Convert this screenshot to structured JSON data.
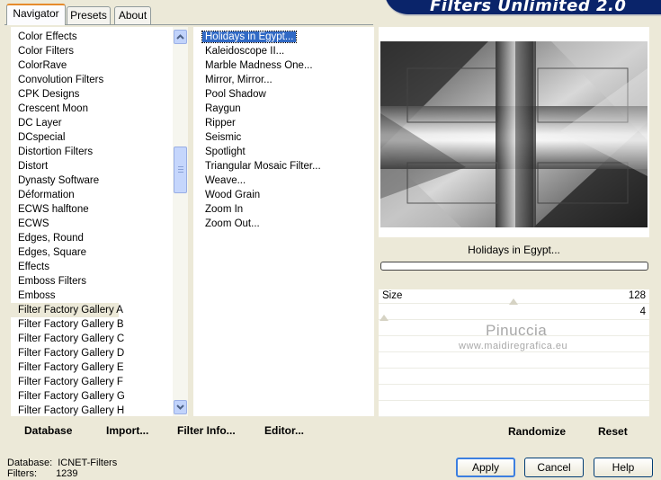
{
  "window": {
    "title": "Filters Unlimited 2.0"
  },
  "tabs": [
    {
      "label": "Navigator"
    },
    {
      "label": "Presets"
    },
    {
      "label": "About"
    }
  ],
  "categories": [
    "Color Effects",
    "Color Filters",
    "ColorRave",
    "Convolution Filters",
    "CPK Designs",
    "Crescent Moon",
    "DC Layer",
    "DCspecial",
    "Distortion Filters",
    "Distort",
    "Dynasty Software",
    "Déformation",
    "ECWS halftone",
    "ECWS",
    "Edges, Round",
    "Edges, Square",
    "Effects",
    "Emboss Filters",
    "Emboss",
    "Filter Factory Gallery A",
    "Filter Factory Gallery B",
    "Filter Factory Gallery C",
    "Filter Factory Gallery D",
    "Filter Factory Gallery E",
    "Filter Factory Gallery F",
    "Filter Factory Gallery G",
    "Filter Factory Gallery H"
  ],
  "selected_category": "Filter Factory Gallery A",
  "filters": [
    "Holidays in Egypt...",
    "Kaleidoscope II...",
    "Marble Madness One...",
    "Mirror, Mirror...",
    "Pool Shadow",
    "Raygun",
    "Ripper",
    "Seismic",
    "Spotlight",
    "Triangular Mosaic Filter...",
    "Weave...",
    "Wood Grain",
    "Zoom In",
    "Zoom Out..."
  ],
  "selected_filter": "Holidays in Egypt...",
  "list_buttons": {
    "database": "Database",
    "import": "Import...",
    "filter_info": "Filter Info...",
    "editor": "Editor..."
  },
  "preview": {
    "filter_name": "Holidays in Egypt..."
  },
  "params": [
    {
      "label": "Size",
      "value": "128"
    },
    {
      "label": "",
      "value": "4"
    }
  ],
  "watermark": {
    "line1": "Pinuccia",
    "line2": "www.maidiregrafica.eu"
  },
  "right_buttons": {
    "randomize": "Randomize",
    "reset": "Reset"
  },
  "status": {
    "database_label": "Database:",
    "database_value": "ICNET-Filters",
    "filters_label": "Filters:",
    "filters_value": "1239"
  },
  "dialog_buttons": {
    "apply": "Apply",
    "cancel": "Cancel",
    "help": "Help"
  },
  "colors": {
    "banner": "#0a246a",
    "selection": "#316ac5",
    "tab_accent": "#e68b2c"
  }
}
